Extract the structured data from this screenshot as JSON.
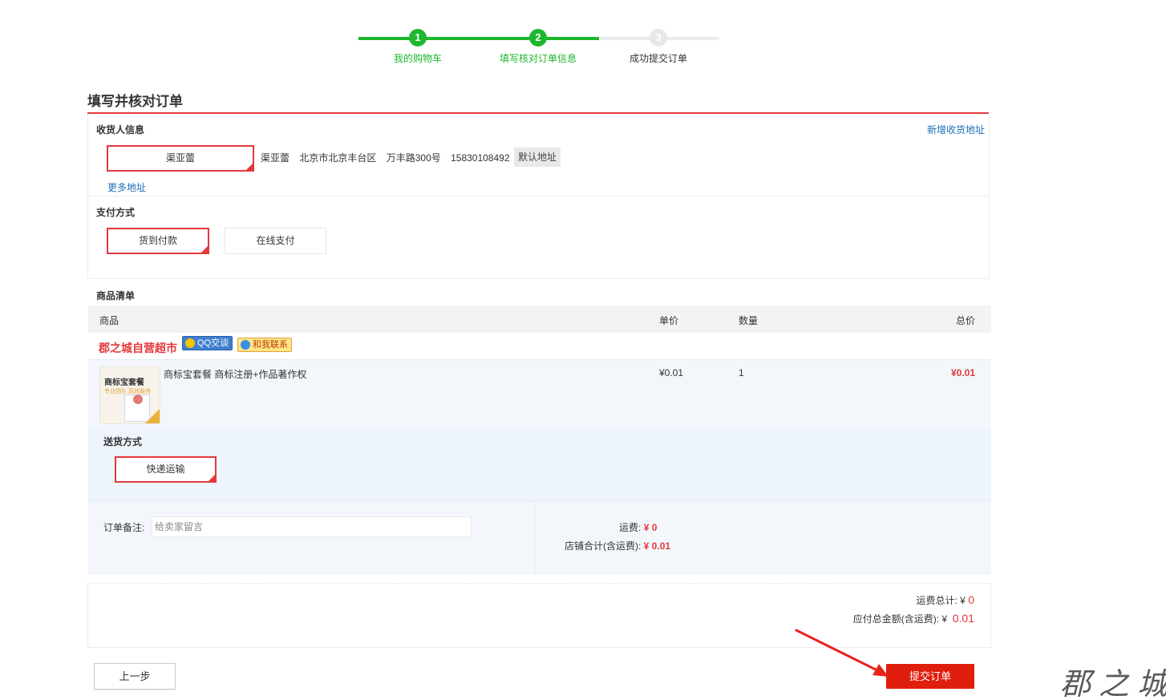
{
  "progress": {
    "steps": [
      {
        "num": "1",
        "label": "我的购物车"
      },
      {
        "num": "2",
        "label": "填写核对订单信息"
      },
      {
        "num": "3",
        "label": "成功提交订单"
      }
    ]
  },
  "page_title": "填写并核对订单",
  "consignee": {
    "section_label": "收货人信息",
    "add_link": "新增收货地址",
    "selected_name": "渠亚蕾",
    "name": "渠亚蕾",
    "region": "北京市北京丰台区",
    "street": "万丰路300号",
    "phone": "15830108492",
    "default_tag": "默认地址",
    "more_link": "更多地址"
  },
  "payment": {
    "section_label": "支付方式",
    "options": [
      "货到付款",
      "在线支付"
    ]
  },
  "goods": {
    "section_label": "商品清单",
    "columns": [
      "商品",
      "单价",
      "数量",
      "总价"
    ],
    "shop_name": "郡之城自营超市",
    "qq_chip": "QQ交谈",
    "contact_chip": "和我联系",
    "items": [
      {
        "name": "商标宝套餐 商标注册+作品著作权",
        "price": "¥0.01",
        "qty": "1",
        "total": "¥0.01",
        "thumb_title": "商标宝套餐",
        "thumb_sub": "专业团队 高效服务",
        "thumb_icon": "certificate-icon"
      }
    ]
  },
  "delivery": {
    "section_label": "送货方式",
    "option": "快递运输"
  },
  "summary": {
    "note_label": "订单备注:",
    "note_placeholder": "给卖家留言",
    "shipping_label": "运费:",
    "shipping_value": "¥ 0",
    "shop_total_label": "店铺合计(含运费):",
    "shop_total_value": "¥ 0.01"
  },
  "totals": {
    "shipping_total_label": "运费总计:",
    "shipping_total_value": "0",
    "payable_label": "应付总金额(含运费):",
    "payable_value": "0.01",
    "currency": "¥"
  },
  "buttons": {
    "prev": "上一步",
    "submit": "提交订单"
  },
  "watermark": "郡之城",
  "colors": {
    "accent": "#e4393c",
    "progress_green": "#1eb72e",
    "submit": "#e01e0d",
    "link": "#1d6fb8"
  }
}
